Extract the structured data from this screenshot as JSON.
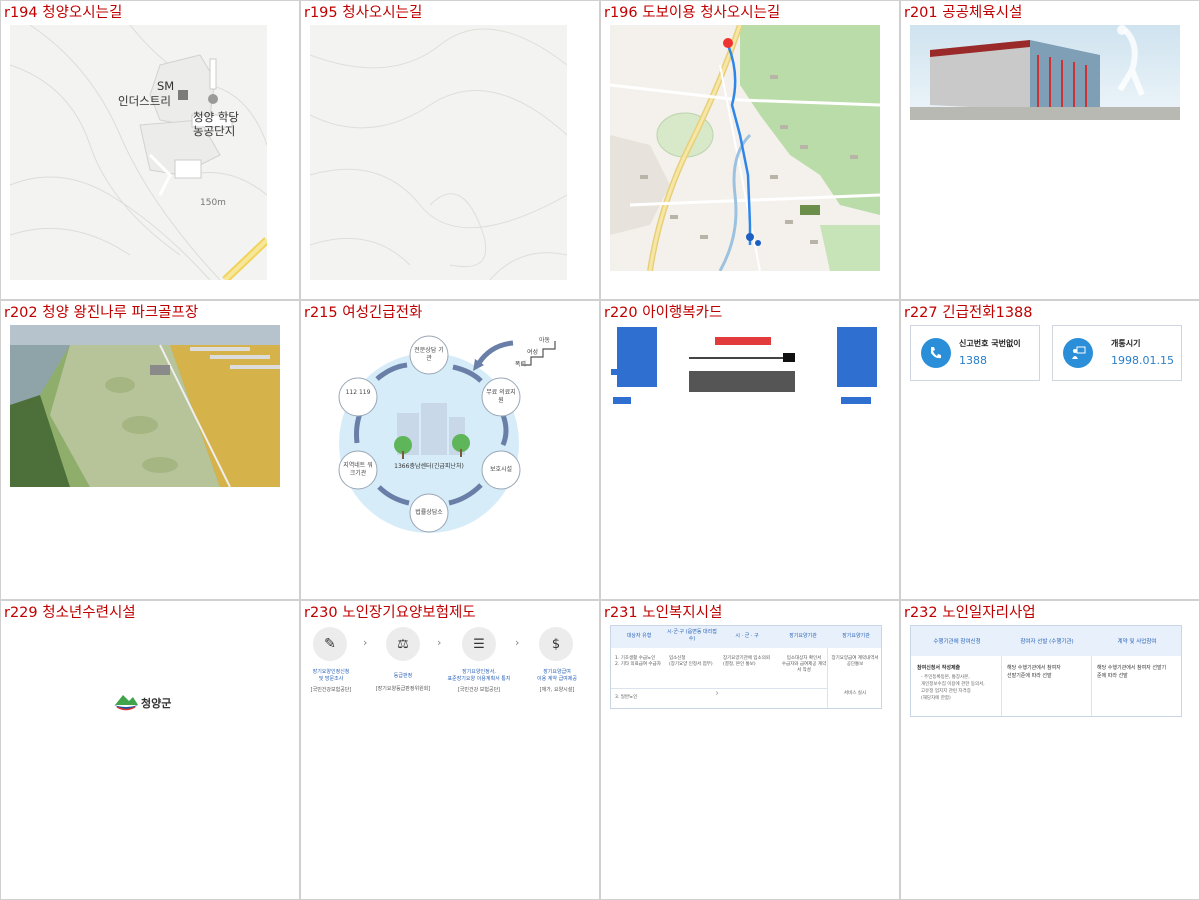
{
  "cells": [
    {
      "title": "r194 청양오시는길"
    },
    {
      "title": "r195 청사오시는길"
    },
    {
      "title": "r196 도보이용 청사오시는길"
    },
    {
      "title": "r201 공공체육시설"
    },
    {
      "title": "r202 청양 왕진나루 파크골프장"
    },
    {
      "title": "r215 여성긴급전화"
    },
    {
      "title": "r220 아이행복카드"
    },
    {
      "title": "r227 긴급전화1388"
    },
    {
      "title": "r229 청소년수련시설"
    },
    {
      "title": "r230 노인장기요양보험제도"
    },
    {
      "title": "r231 노인복지시설"
    },
    {
      "title": "r232 노인일자리사업"
    }
  ],
  "map194": {
    "label_sm": "SM",
    "label_sm2": "인더스트리",
    "label_park1": "청양 학당",
    "label_park2": "농공단지",
    "elevation": "150m"
  },
  "diagram215": {
    "center": "1366충남센터(긴급피난처)",
    "nodes": [
      "전문상담 기관",
      "무료 의료지원",
      "보호시설",
      "법률상담소",
      "지역네트 워크기관",
      "112 119"
    ],
    "steps": [
      "아동",
      "여성",
      "폭력"
    ]
  },
  "card227": {
    "left_title": "신고번호 국번없이",
    "left_value": "1388",
    "right_title": "개통시기",
    "right_value": "1998.01.15"
  },
  "logo229": {
    "text": "청양군"
  },
  "flow230": {
    "steps": [
      {
        "t1": "장기요양인정신청",
        "t2": "및 방문조사",
        "sub": "[국민건강보험공단]"
      },
      {
        "t1": "등급판정",
        "t2": "",
        "sub": "[장기요양등급판정위원회]"
      },
      {
        "t1": "장기요양인정서,",
        "t2": "표준장기요양 이용계획서 통지",
        "sub": "[국민건강 보험공단]"
      },
      {
        "t1": "장기요양급여",
        "t2": "이용 계약 급여제공",
        "sub": "[재가, 요양시설]"
      }
    ]
  },
  "table231": {
    "headers": [
      "대상자 유형",
      "시·군·구 (읍면동 대리접수)",
      "시 · 군 · 구",
      "장기요양기관",
      "장기요양기관"
    ],
    "c1": "1. 기초생활 수급노인\n2. 기타 의료급여 수급자",
    "c2": "입소신청\n(장기요양 인정서 첨부)",
    "c3": "장기요양기관에 입소의뢰\n(결정, 본인 통보)",
    "c4": "입소대상자 확인서\n수급자와 급여제공 계약서 작성",
    "c5": "장기요양급여 계약내역서 공단통보",
    "c5b": "서비스 실시",
    "row2": "3. 일반노인"
  },
  "flow232": {
    "headers": [
      "수행기관에 참여신청",
      "참여자 선발 (수행기관)",
      "계약 및 사업참여"
    ],
    "col1_title": "참여신청서 작성제출",
    "col1_items": [
      "- 주민등록등본, 통장사본,",
      "개인정보수집 이용에 관한 동의서,",
      "고유정 업지지 관련 자격증",
      "(해당자에 한함)"
    ],
    "col2": [
      "해당 수행기관에서 참여자",
      "선발기준에 따라 선발"
    ],
    "col3": [
      "해당 수행기관에서 참여자 선발기",
      "준에 따라 선발"
    ]
  }
}
